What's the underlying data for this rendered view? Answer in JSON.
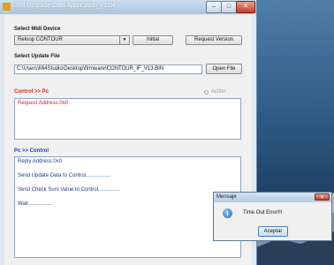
{
  "window": {
    "title": "USB Upgrade Data Application_v1.04",
    "minimize_glyph": "–",
    "maximize_glyph": "□",
    "close_glyph": "✕"
  },
  "device": {
    "label": "Select Midi Device",
    "selected": "Reloop CONTOUR",
    "initial_button": "Initial",
    "request_version_button": "Request Version"
  },
  "update_file": {
    "label": "Select Update File",
    "path": "C:\\Users\\Mi4Studio\\Desktop\\firmware\\CONTOUR_IF_V13.BIN",
    "open_button": "Open File"
  },
  "control_to_pc": {
    "label": "Control >> Pc",
    "action_label": "Action",
    "lines": [
      "Request Address:0x0"
    ]
  },
  "pc_to_control": {
    "label": "Pc >> Control",
    "lines": [
      "Reply Address:0x0",
      "Send Update Data to Control.................",
      "Send Check Sum Value to Control...............",
      "Wait................"
    ]
  },
  "dialog": {
    "title": "Mensaje",
    "close_glyph": "✕",
    "icon_glyph": "i",
    "message": "Time Out Error!!!",
    "ok_button": "Aceptar"
  },
  "colors": {
    "control_to_pc_label": "#e02020",
    "pc_to_control_label": "#1e3ab0",
    "log_text": "#1e3a8a",
    "request_line": "#d02020"
  }
}
